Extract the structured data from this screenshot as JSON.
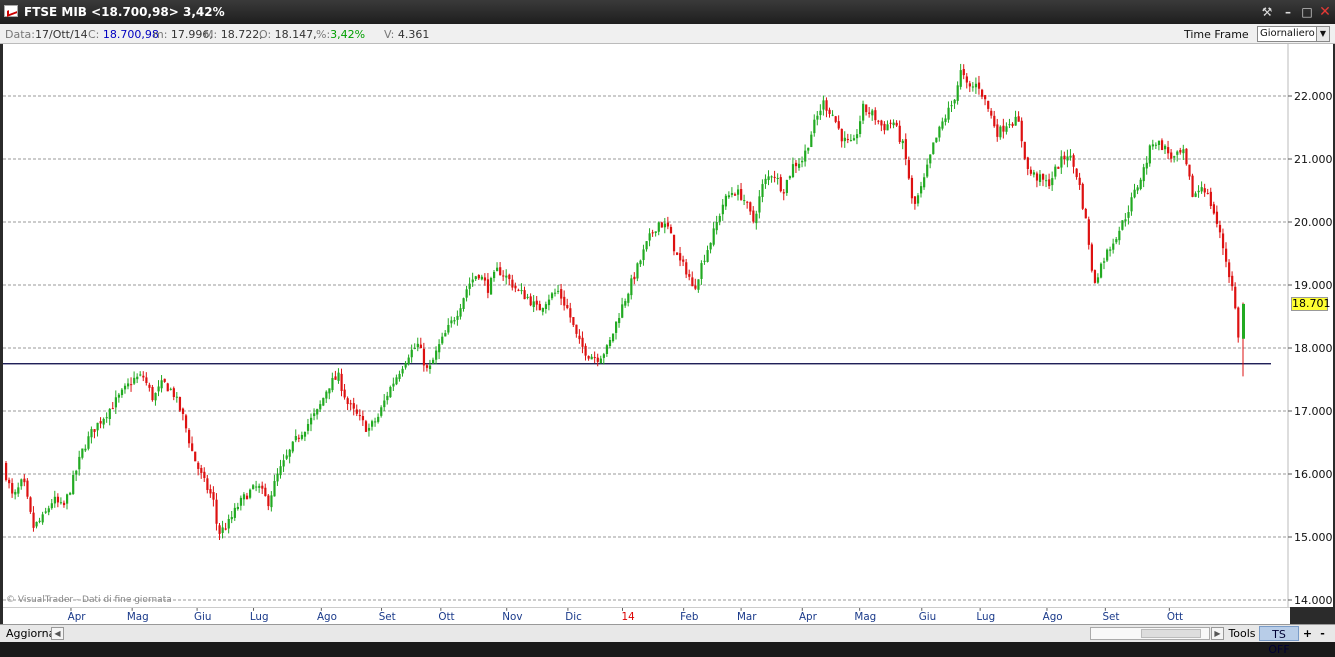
{
  "window": {
    "title": "FTSE MIB <18.700,98> 3,42%"
  },
  "infobar": {
    "data_label": "Data:",
    "data_value": "17/Ott/14",
    "close_label": "C:",
    "close_value": "18.700,98",
    "min_label": "m:",
    "min_value": "17.996,",
    "max_label": "M:",
    "max_value": "18.722,",
    "open_label": "O:",
    "open_value": "18.147,",
    "pct_label": "%:",
    "pct_value": "3,42%",
    "vol_label": "V:",
    "vol_value": "4.361",
    "timeframe_label": "Time Frame",
    "timeframe_value": "Giornaliero"
  },
  "bottombar": {
    "refresh_label": "Aggiorna",
    "tools_label": "Tools",
    "ts_label": "TS OFF",
    "plus_label": "+",
    "minus_label": "-"
  },
  "watermark": "© VisualTrader - Dati di fine giornata",
  "price_badge": "18.701",
  "colors": {
    "up": "#22aa22",
    "down": "#dd1111",
    "grid": "#999999",
    "support_line": "#000040",
    "year_marker": "#dd0000"
  },
  "chart_data": {
    "type": "candlestick",
    "title": "FTSE MIB",
    "y_ticks": [
      "14.000",
      "15.000",
      "16.000",
      "17.000",
      "18.000",
      "19.000",
      "20.000",
      "21.000",
      "22.000"
    ],
    "ylim": [
      14000,
      22600
    ],
    "x_month_labels": [
      "Apr",
      "Mag",
      "Giu",
      "Lug",
      "Ago",
      "Set",
      "Ott",
      "Nov",
      "Dic",
      "14",
      "Feb",
      "Mar",
      "Apr",
      "Mag",
      "Giu",
      "Lug",
      "Ago",
      "Set",
      "Ott"
    ],
    "year_marker_label": "14",
    "support_level": 17750,
    "last_close": 18700.98,
    "path": [
      [
        0,
        16150
      ],
      [
        10,
        15600
      ],
      [
        20,
        15900
      ],
      [
        30,
        15150
      ],
      [
        40,
        15300
      ],
      [
        50,
        15600
      ],
      [
        60,
        15450
      ],
      [
        70,
        15900
      ],
      [
        80,
        16400
      ],
      [
        90,
        16700
      ],
      [
        100,
        16900
      ],
      [
        110,
        17100
      ],
      [
        120,
        17300
      ],
      [
        130,
        17500
      ],
      [
        140,
        17550
      ],
      [
        150,
        17200
      ],
      [
        160,
        17450
      ],
      [
        170,
        17300
      ],
      [
        180,
        16900
      ],
      [
        190,
        16300
      ],
      [
        200,
        15900
      ],
      [
        210,
        15600
      ],
      [
        215,
        15050
      ],
      [
        225,
        15200
      ],
      [
        235,
        15500
      ],
      [
        245,
        15700
      ],
      [
        255,
        15800
      ],
      [
        265,
        15550
      ],
      [
        275,
        16000
      ],
      [
        285,
        16300
      ],
      [
        295,
        16600
      ],
      [
        305,
        16800
      ],
      [
        315,
        17000
      ],
      [
        325,
        17400
      ],
      [
        335,
        17550
      ],
      [
        345,
        17100
      ],
      [
        355,
        16900
      ],
      [
        365,
        16700
      ],
      [
        375,
        16900
      ],
      [
        385,
        17300
      ],
      [
        395,
        17600
      ],
      [
        405,
        17900
      ],
      [
        415,
        18050
      ],
      [
        425,
        17600
      ],
      [
        435,
        18000
      ],
      [
        445,
        18300
      ],
      [
        455,
        18600
      ],
      [
        465,
        19000
      ],
      [
        475,
        19200
      ],
      [
        485,
        18950
      ],
      [
        495,
        19250
      ],
      [
        505,
        19100
      ],
      [
        515,
        18900
      ],
      [
        525,
        18800
      ],
      [
        535,
        18600
      ],
      [
        545,
        18800
      ],
      [
        555,
        18900
      ],
      [
        565,
        18600
      ],
      [
        575,
        18100
      ],
      [
        585,
        17900
      ],
      [
        595,
        17850
      ],
      [
        605,
        18000
      ],
      [
        615,
        18500
      ],
      [
        625,
        18900
      ],
      [
        635,
        19300
      ],
      [
        645,
        19700
      ],
      [
        655,
        20000
      ],
      [
        665,
        19900
      ],
      [
        675,
        19400
      ],
      [
        685,
        19200
      ],
      [
        690,
        18900
      ],
      [
        700,
        19400
      ],
      [
        710,
        19800
      ],
      [
        720,
        20300
      ],
      [
        730,
        20500
      ],
      [
        740,
        20400
      ],
      [
        750,
        20000
      ],
      [
        760,
        20600
      ],
      [
        770,
        20800
      ],
      [
        780,
        20500
      ],
      [
        790,
        20900
      ],
      [
        800,
        21000
      ],
      [
        810,
        21500
      ],
      [
        820,
        21900
      ],
      [
        830,
        21700
      ],
      [
        840,
        21300
      ],
      [
        850,
        21200
      ],
      [
        860,
        21800
      ],
      [
        870,
        21700
      ],
      [
        880,
        21500
      ],
      [
        890,
        21600
      ],
      [
        900,
        21200
      ],
      [
        905,
        20800
      ],
      [
        910,
        20200
      ],
      [
        920,
        20600
      ],
      [
        930,
        21200
      ],
      [
        940,
        21600
      ],
      [
        950,
        21900
      ],
      [
        958,
        22400
      ],
      [
        965,
        22100
      ],
      [
        975,
        22200
      ],
      [
        985,
        21800
      ],
      [
        995,
        21400
      ],
      [
        1005,
        21600
      ],
      [
        1015,
        21600
      ],
      [
        1025,
        20800
      ],
      [
        1035,
        20700
      ],
      [
        1045,
        20600
      ],
      [
        1055,
        20900
      ],
      [
        1065,
        21100
      ],
      [
        1075,
        20700
      ],
      [
        1085,
        19800
      ],
      [
        1090,
        19000
      ],
      [
        1100,
        19400
      ],
      [
        1110,
        19700
      ],
      [
        1120,
        20000
      ],
      [
        1130,
        20400
      ],
      [
        1140,
        20800
      ],
      [
        1150,
        21300
      ],
      [
        1160,
        21200
      ],
      [
        1170,
        21000
      ],
      [
        1180,
        21100
      ],
      [
        1190,
        20400
      ],
      [
        1200,
        20600
      ],
      [
        1210,
        20200
      ],
      [
        1220,
        19600
      ],
      [
        1230,
        18900
      ],
      [
        1236,
        18100
      ],
      [
        1241,
        18700
      ]
    ]
  }
}
